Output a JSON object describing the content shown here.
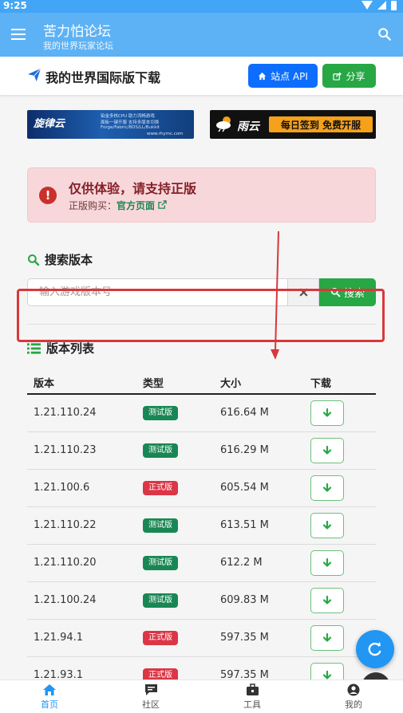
{
  "status": {
    "time": "9:25"
  },
  "appbar": {
    "title": "苦力怕论坛",
    "subtitle": "我的世界玩家论坛"
  },
  "page": {
    "title": "我的世界国际版下载",
    "api_label": "站点 API",
    "share_label": "分享"
  },
  "banners": {
    "left": {
      "logo": "旋律云",
      "lines": [
        "铂金多核CPU  助力流畅游戏",
        "面板一键开服  支持多版本切换",
        "Forge/Fabric/BDS/LL/Bukkit",
        "www.rhymc.com"
      ]
    },
    "right": {
      "name": "雨云",
      "tag": "每日签到 免费开服"
    }
  },
  "alert": {
    "title": "仅供体验，请支持正版",
    "buy_prefix": "正版购买：",
    "buy_link": "官方页面"
  },
  "search": {
    "section_title": "搜索版本",
    "placeholder": "输入游戏版本号",
    "button_label": "搜索"
  },
  "list": {
    "section_title": "版本列表",
    "headers": {
      "version": "版本",
      "type": "类型",
      "size": "大小",
      "download": "下载"
    },
    "rows": [
      {
        "version": "1.21.110.24",
        "type": "测试版",
        "size": "616.64 M",
        "color": "#198754"
      },
      {
        "version": "1.21.110.23",
        "type": "测试版",
        "size": "616.29 M",
        "color": "#198754"
      },
      {
        "version": "1.21.100.6",
        "type": "正式版",
        "size": "605.54 M",
        "color": "#dc3545"
      },
      {
        "version": "1.21.110.22",
        "type": "测试版",
        "size": "613.51 M",
        "color": "#198754"
      },
      {
        "version": "1.21.110.20",
        "type": "测试版",
        "size": "612.2 M",
        "color": "#198754"
      },
      {
        "version": "1.21.100.24",
        "type": "测试版",
        "size": "609.83 M",
        "color": "#198754"
      },
      {
        "version": "1.21.94.1",
        "type": "正式版",
        "size": "597.35 M",
        "color": "#dc3545"
      },
      {
        "version": "1.21.93.1",
        "type": "正式版",
        "size": "597.35 M",
        "color": "#dc3545"
      }
    ]
  },
  "nav": {
    "home": "首页",
    "community": "社区",
    "tools": "工具",
    "mine": "我的"
  },
  "colors": {
    "primary": "#2196f3",
    "success": "#28a745",
    "danger": "#dc3545",
    "annotation": "#d9373a"
  }
}
